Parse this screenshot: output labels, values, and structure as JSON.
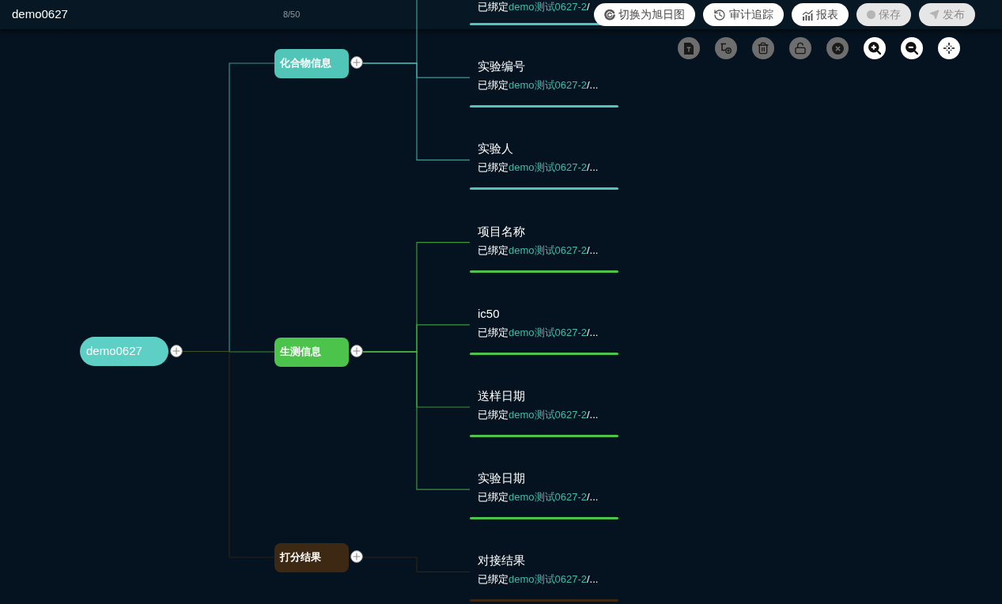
{
  "header": {
    "title": "demo0627",
    "counter": "8/50"
  },
  "actions": [
    {
      "kind": "sunburst",
      "label": "切换为旭日图",
      "disabled": false
    },
    {
      "kind": "audit",
      "label": "审计追踪",
      "disabled": false
    },
    {
      "kind": "report",
      "label": "报表",
      "disabled": false
    },
    {
      "kind": "save",
      "label": "保存",
      "disabled": true
    },
    {
      "kind": "publish",
      "label": "发布",
      "disabled": true
    }
  ],
  "tools": [
    {
      "kind": "text",
      "disabled": true
    },
    {
      "kind": "add_child",
      "disabled": true
    },
    {
      "kind": "delete",
      "disabled": true
    },
    {
      "kind": "unlock",
      "disabled": true
    },
    {
      "kind": "close",
      "disabled": true
    },
    {
      "kind": "zoom_in",
      "disabled": false
    },
    {
      "kind": "zoom_out",
      "disabled": false
    },
    {
      "kind": "fit",
      "disabled": false
    }
  ],
  "mindmap": {
    "root": {
      "label": "demo0627"
    },
    "children": [
      {
        "label": "化合物信息",
        "color": "#52c5b9",
        "children": [
          {
            "binding": {
              "prefix": "已绑定",
              "source": "demo测试0627-2",
              "rest": "/"
            }
          },
          {
            "title": "实验编号",
            "binding": {
              "prefix": "已绑定",
              "source": "demo测试0627-2",
              "rest": "/..."
            }
          },
          {
            "title": "实验人",
            "binding": {
              "prefix": "已绑定",
              "source": "demo测试0627-2",
              "rest": "/..."
            }
          }
        ]
      },
      {
        "label": "生测信息",
        "color": "#4cc34a",
        "children": [
          {
            "title": "项目名称",
            "binding": {
              "prefix": "已绑定",
              "source": "demo测试0627-2",
              "rest": "/..."
            }
          },
          {
            "title": "ic50",
            "binding": {
              "prefix": "已绑定",
              "source": "demo测试0627-2",
              "rest": "/..."
            }
          },
          {
            "title": "送样日期",
            "binding": {
              "prefix": "已绑定",
              "source": "demo测试0627-2",
              "rest": "/..."
            }
          },
          {
            "title": "实验日期",
            "binding": {
              "prefix": "已绑定",
              "source": "demo测试0627-2",
              "rest": "/..."
            }
          }
        ]
      },
      {
        "label": "打分结果",
        "color": "#3d2813",
        "children": [
          {
            "title": "对接结果",
            "binding": {
              "prefix": "已绑定",
              "source": "demo测试0627-2",
              "rest": "/..."
            }
          }
        ]
      }
    ]
  }
}
